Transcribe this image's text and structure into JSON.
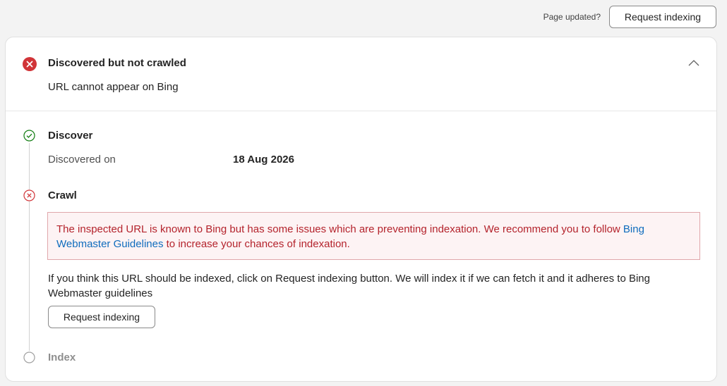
{
  "topbar": {
    "page_updated_label": "Page updated?",
    "request_indexing_label": "Request indexing"
  },
  "status": {
    "title": "Discovered but not crawled",
    "subtitle": "URL cannot appear on Bing",
    "status_color": "#d13438",
    "icon": "error-circle-icon"
  },
  "steps": {
    "discover": {
      "label": "Discover",
      "state": "success",
      "color": "#107c10",
      "rows": [
        {
          "label": "Discovered on",
          "value": "18 Aug 2026"
        }
      ]
    },
    "crawl": {
      "label": "Crawl",
      "state": "error",
      "color": "#d13438",
      "alert_text_before": "The inspected URL is known to Bing but has some issues which are preventing indexation. We recommend you to follow ",
      "alert_link": "Bing Webmaster Guidelines",
      "alert_text_after": " to increase your chances of indexation.",
      "info_text": "If you think this URL should be indexed, click on Request indexing button. We will index it if we can fetch it and it adheres to Bing Webmaster guidelines",
      "button_label": "Request indexing"
    },
    "index": {
      "label": "Index",
      "state": "pending"
    }
  },
  "colors": {
    "accent_link": "#0f6cbd",
    "alert_bg": "#fdf3f4",
    "alert_border": "#e0a6ab",
    "alert_text": "#b4232c"
  }
}
